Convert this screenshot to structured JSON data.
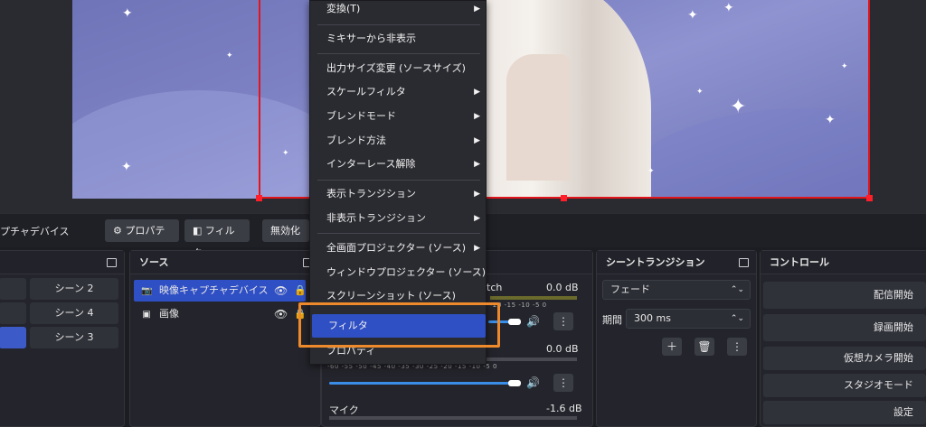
{
  "toolbar": {
    "source_label": "プチャデバイス",
    "properties_label": "プロパティ",
    "filter_label": "フィルタ",
    "disable_label": "無効化"
  },
  "scenes": {
    "buttons": [
      "シーン 2",
      "シーン 4",
      "シーン 3"
    ]
  },
  "sources": {
    "title": "ソース",
    "items": [
      {
        "label": "映像キャプチャデバイス"
      },
      {
        "label": "画像"
      }
    ]
  },
  "mixer": {
    "channels": [
      {
        "name": "tch",
        "db": "0.0 dB"
      },
      {
        "name": "",
        "db": "0.0 dB"
      },
      {
        "name": "マイク",
        "db": "-1.6 dB"
      }
    ],
    "scale": "-60 -55 -50 -45 -40 -35 -30 -25 -20 -15 -10 -5 0",
    "scale_short": "-20 -15 -10 -5 0"
  },
  "transitions": {
    "title": "シーントランジション",
    "type": "フェード",
    "duration_label": "期間",
    "duration_value": "300 ms"
  },
  "controls": {
    "title": "コントロール",
    "buttons": [
      "配信開始",
      "録画開始",
      "仮想カメラ開始",
      "スタジオモード",
      "設定"
    ]
  },
  "context_menu": {
    "items": [
      {
        "label": "変換(T)",
        "submenu": true
      },
      {
        "label": "ミキサーから非表示",
        "submenu": false
      },
      {
        "label": "出力サイズ変更 (ソースサイズ)",
        "submenu": false
      },
      {
        "label": "スケールフィルタ",
        "submenu": true
      },
      {
        "label": "ブレンドモード",
        "submenu": true
      },
      {
        "label": "ブレンド方法",
        "submenu": true
      },
      {
        "label": "インターレース解除",
        "submenu": true
      },
      {
        "label": "表示トランジション",
        "submenu": true
      },
      {
        "label": "非表示トランジション",
        "submenu": true
      },
      {
        "label": "全画面プロジェクター (ソース)",
        "submenu": true
      },
      {
        "label": "ウィンドウプロジェクター (ソース)",
        "submenu": false
      },
      {
        "label": "スクリーンショット (ソース)",
        "submenu": false
      },
      {
        "label": "フィルタ",
        "submenu": false
      },
      {
        "label": "プロパティ",
        "submenu": false
      }
    ]
  },
  "colors": {
    "accent": "#2f4fc4",
    "highlight_box": "#ee8a2b",
    "selection_border": "#e2141c",
    "guide": "#2fd12f"
  }
}
